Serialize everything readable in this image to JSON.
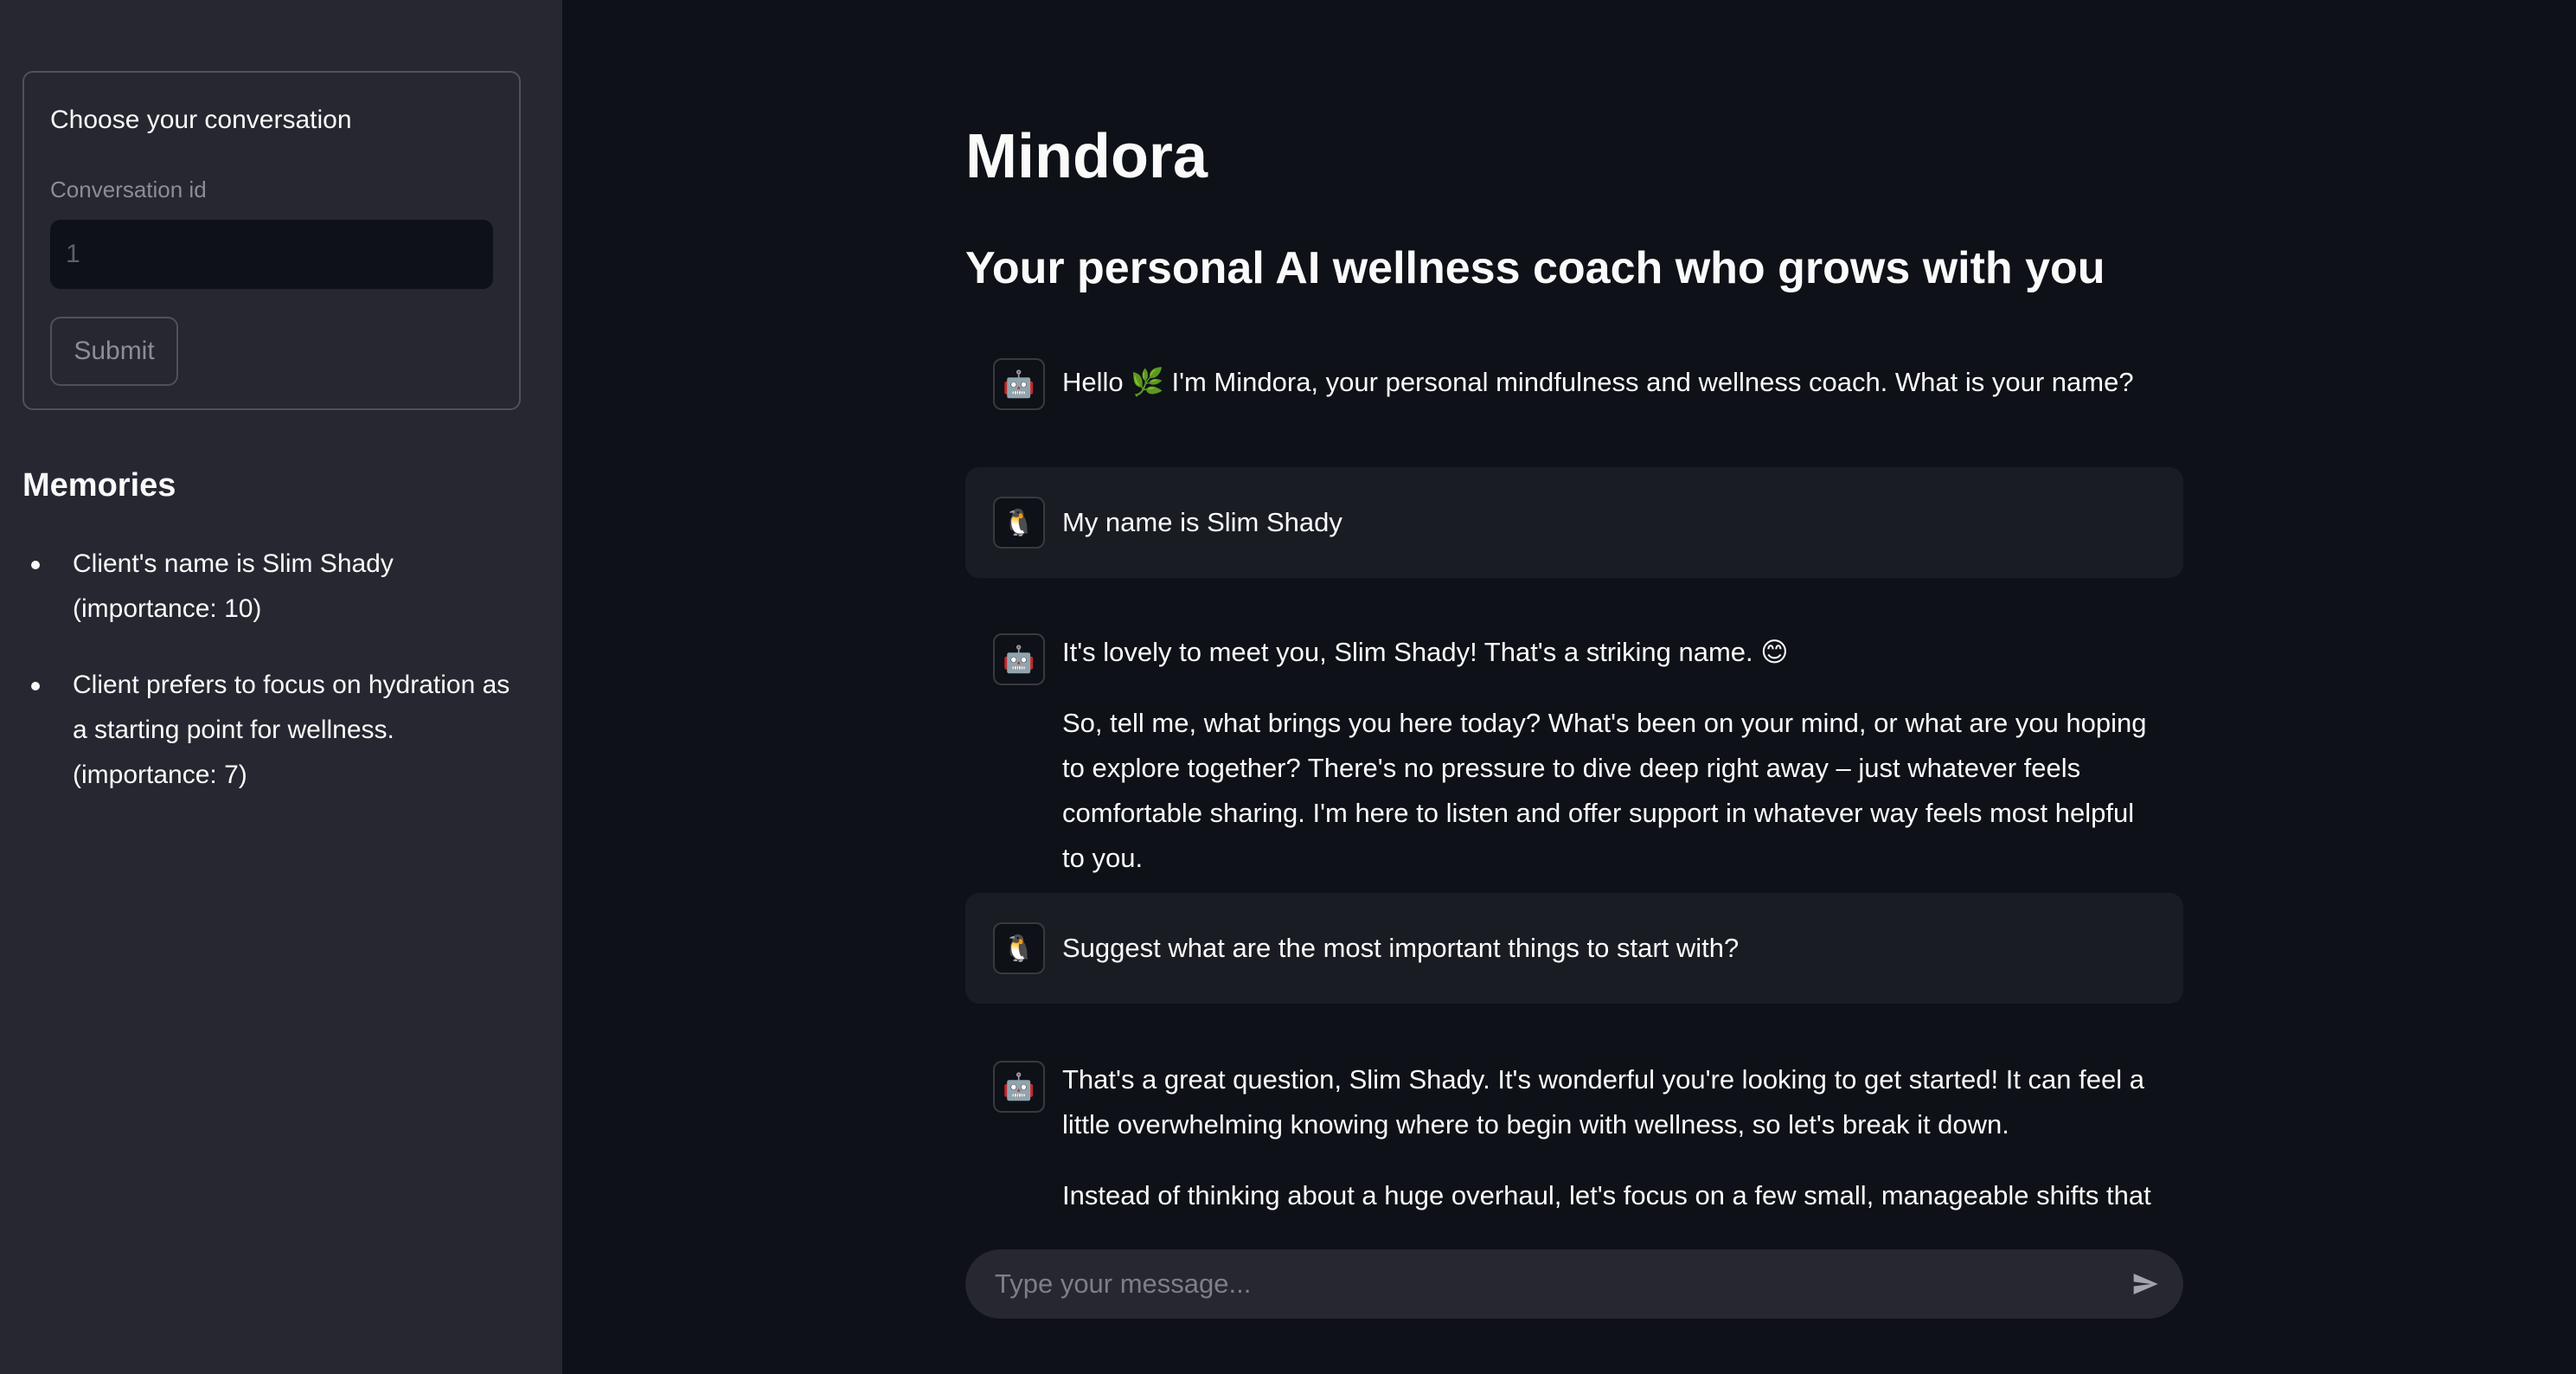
{
  "sidebar": {
    "form": {
      "title": "Choose your conversation",
      "field_label": "Conversation id",
      "field_placeholder": "1",
      "submit_label": "Submit"
    },
    "memories": {
      "title": "Memories",
      "items": [
        "Client's name is Slim Shady (importance: 10)",
        "Client prefers to focus on hydration as a starting point for wellness. (importance: 7)"
      ]
    }
  },
  "main": {
    "title": "Mindora",
    "subtitle": "Your personal AI wellness coach who grows with you",
    "messages": [
      {
        "role": "assistant",
        "avatar_icon": "robot-icon",
        "paragraphs": [
          "Hello 🌿 I'm Mindora, your personal mindfulness and wellness coach. What is your name?"
        ]
      },
      {
        "role": "user",
        "avatar_icon": "penguin-icon",
        "paragraphs": [
          "My name is Slim Shady"
        ]
      },
      {
        "role": "assistant",
        "avatar_icon": "robot-icon",
        "paragraphs": [
          "It's lovely to meet you, Slim Shady! That's a striking name. 😊",
          "So, tell me, what brings you here today? What's been on your mind, or what are you hoping to explore together? There's no pressure to dive deep right away – just whatever feels comfortable sharing. I'm here to listen and offer support in whatever way feels most helpful to you."
        ]
      },
      {
        "role": "user",
        "avatar_icon": "penguin-icon",
        "paragraphs": [
          "Suggest what are the most important things to start with?"
        ]
      },
      {
        "role": "assistant",
        "avatar_icon": "robot-icon",
        "paragraphs": [
          "That's a great question, Slim Shady. It's wonderful you're looking to get started! It can feel a little overwhelming knowing where to begin with wellness, so let's break it down.",
          "Instead of thinking about a huge overhaul, let's focus on a few small, manageable shifts that can"
        ]
      }
    ],
    "chat_input": {
      "placeholder": "Type your message..."
    }
  },
  "colors": {
    "app_background": "#0e1117",
    "sidebar_background": "#262730",
    "user_message_background": "#1a1c24",
    "text": "#fafafa",
    "muted_text": "#8b8d96"
  }
}
